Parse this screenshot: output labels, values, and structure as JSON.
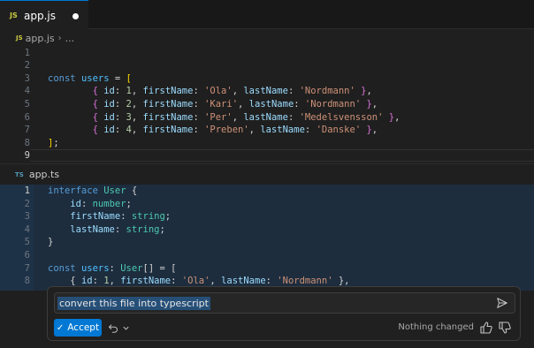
{
  "tab": {
    "icon": "JS",
    "filename": "app.js"
  },
  "breadcrumb": {
    "icon": "JS",
    "file": "app.js",
    "separator": "›",
    "more": "..."
  },
  "editor_lines": [
    {
      "num": "1",
      "tokens": []
    },
    {
      "num": "2",
      "tokens": []
    },
    {
      "num": "3",
      "tokens": [
        {
          "c": "kw",
          "t": "const"
        },
        {
          "c": "plain",
          "t": " "
        },
        {
          "c": "var",
          "t": "users"
        },
        {
          "c": "plain",
          "t": " = "
        },
        {
          "c": "br1",
          "t": "["
        }
      ]
    },
    {
      "num": "4",
      "tokens": [
        {
          "c": "plain",
          "t": "        "
        },
        {
          "c": "br2",
          "t": "{"
        },
        {
          "c": "plain",
          "t": " "
        },
        {
          "c": "prop",
          "t": "id"
        },
        {
          "c": "plain",
          "t": ": "
        },
        {
          "c": "num",
          "t": "1"
        },
        {
          "c": "plain",
          "t": ", "
        },
        {
          "c": "prop",
          "t": "firstName"
        },
        {
          "c": "plain",
          "t": ": "
        },
        {
          "c": "str",
          "t": "'Ola'"
        },
        {
          "c": "plain",
          "t": ", "
        },
        {
          "c": "prop",
          "t": "lastName"
        },
        {
          "c": "plain",
          "t": ": "
        },
        {
          "c": "str",
          "t": "'Nordmann'"
        },
        {
          "c": "plain",
          "t": " "
        },
        {
          "c": "br2",
          "t": "}"
        },
        {
          "c": "plain",
          "t": ","
        }
      ]
    },
    {
      "num": "5",
      "tokens": [
        {
          "c": "plain",
          "t": "        "
        },
        {
          "c": "br2",
          "t": "{"
        },
        {
          "c": "plain",
          "t": " "
        },
        {
          "c": "prop",
          "t": "id"
        },
        {
          "c": "plain",
          "t": ": "
        },
        {
          "c": "num",
          "t": "2"
        },
        {
          "c": "plain",
          "t": ", "
        },
        {
          "c": "prop",
          "t": "firstName"
        },
        {
          "c": "plain",
          "t": ": "
        },
        {
          "c": "str",
          "t": "'Kari'"
        },
        {
          "c": "plain",
          "t": ", "
        },
        {
          "c": "prop",
          "t": "lastName"
        },
        {
          "c": "plain",
          "t": ": "
        },
        {
          "c": "str",
          "t": "'Nordmann'"
        },
        {
          "c": "plain",
          "t": " "
        },
        {
          "c": "br2",
          "t": "}"
        },
        {
          "c": "plain",
          "t": ","
        }
      ]
    },
    {
      "num": "6",
      "tokens": [
        {
          "c": "plain",
          "t": "        "
        },
        {
          "c": "br2",
          "t": "{"
        },
        {
          "c": "plain",
          "t": " "
        },
        {
          "c": "prop",
          "t": "id"
        },
        {
          "c": "plain",
          "t": ": "
        },
        {
          "c": "num",
          "t": "3"
        },
        {
          "c": "plain",
          "t": ", "
        },
        {
          "c": "prop",
          "t": "firstName"
        },
        {
          "c": "plain",
          "t": ": "
        },
        {
          "c": "str",
          "t": "'Per'"
        },
        {
          "c": "plain",
          "t": ", "
        },
        {
          "c": "prop",
          "t": "lastName"
        },
        {
          "c": "plain",
          "t": ": "
        },
        {
          "c": "str",
          "t": "'Medelsvensson'"
        },
        {
          "c": "plain",
          "t": " "
        },
        {
          "c": "br2",
          "t": "}"
        },
        {
          "c": "plain",
          "t": ","
        }
      ]
    },
    {
      "num": "7",
      "tokens": [
        {
          "c": "plain",
          "t": "        "
        },
        {
          "c": "br2",
          "t": "{"
        },
        {
          "c": "plain",
          "t": " "
        },
        {
          "c": "prop",
          "t": "id"
        },
        {
          "c": "plain",
          "t": ": "
        },
        {
          "c": "num",
          "t": "4"
        },
        {
          "c": "plain",
          "t": ", "
        },
        {
          "c": "prop",
          "t": "firstName"
        },
        {
          "c": "plain",
          "t": ": "
        },
        {
          "c": "str",
          "t": "'Preben'"
        },
        {
          "c": "plain",
          "t": ", "
        },
        {
          "c": "prop",
          "t": "lastName"
        },
        {
          "c": "plain",
          "t": ": "
        },
        {
          "c": "str",
          "t": "'Danske'"
        },
        {
          "c": "plain",
          "t": " "
        },
        {
          "c": "br2",
          "t": "}"
        },
        {
          "c": "plain",
          "t": ","
        }
      ]
    },
    {
      "num": "8",
      "tokens": [
        {
          "c": "br1",
          "t": "]"
        },
        {
          "c": "plain",
          "t": ";"
        }
      ]
    },
    {
      "num": "9",
      "active": true,
      "tokens": []
    }
  ],
  "diff": {
    "icon": "TS",
    "filename": "app.ts",
    "lines": [
      {
        "num": "1",
        "active": true,
        "tokens": [
          {
            "c": "kw",
            "t": "interface"
          },
          {
            "c": "plain",
            "t": " "
          },
          {
            "c": "typ",
            "t": "User"
          },
          {
            "c": "plain",
            "t": " {"
          }
        ]
      },
      {
        "num": "2",
        "tokens": [
          {
            "c": "plain",
            "t": "    "
          },
          {
            "c": "prop",
            "t": "id"
          },
          {
            "c": "plain",
            "t": ": "
          },
          {
            "c": "typ",
            "t": "number"
          },
          {
            "c": "plain",
            "t": ";"
          }
        ]
      },
      {
        "num": "3",
        "tokens": [
          {
            "c": "plain",
            "t": "    "
          },
          {
            "c": "prop",
            "t": "firstName"
          },
          {
            "c": "plain",
            "t": ": "
          },
          {
            "c": "typ",
            "t": "string"
          },
          {
            "c": "plain",
            "t": ";"
          }
        ]
      },
      {
        "num": "4",
        "tokens": [
          {
            "c": "plain",
            "t": "    "
          },
          {
            "c": "prop",
            "t": "lastName"
          },
          {
            "c": "plain",
            "t": ": "
          },
          {
            "c": "typ",
            "t": "string"
          },
          {
            "c": "plain",
            "t": ";"
          }
        ]
      },
      {
        "num": "5",
        "tokens": [
          {
            "c": "plain",
            "t": "}"
          }
        ]
      },
      {
        "num": "6",
        "tokens": []
      },
      {
        "num": "7",
        "tokens": [
          {
            "c": "kw",
            "t": "const"
          },
          {
            "c": "plain",
            "t": " "
          },
          {
            "c": "var",
            "t": "users"
          },
          {
            "c": "plain",
            "t": ": "
          },
          {
            "c": "typ",
            "t": "User"
          },
          {
            "c": "plain",
            "t": "[] = ["
          }
        ]
      },
      {
        "num": "8",
        "tokens": [
          {
            "c": "plain",
            "t": "    { "
          },
          {
            "c": "prop",
            "t": "id"
          },
          {
            "c": "plain",
            "t": ": "
          },
          {
            "c": "num",
            "t": "1"
          },
          {
            "c": "plain",
            "t": ", "
          },
          {
            "c": "prop",
            "t": "firstName"
          },
          {
            "c": "plain",
            "t": ": "
          },
          {
            "c": "str",
            "t": "'Ola'"
          },
          {
            "c": "plain",
            "t": ", "
          },
          {
            "c": "prop",
            "t": "lastName"
          },
          {
            "c": "plain",
            "t": ": "
          },
          {
            "c": "str",
            "t": "'Nordmann'"
          },
          {
            "c": "plain",
            "t": " },"
          }
        ]
      }
    ]
  },
  "chat": {
    "prompt": "convert this file into typescript",
    "accept_label": "Accept",
    "status": "Nothing changed",
    "icons": {
      "send": "send-icon",
      "undo": "undo-icon",
      "chevron": "chevron-down-icon",
      "thumbs_up": "thumbs-up-icon",
      "thumbs_down": "thumbs-down-icon",
      "check": "check-icon"
    }
  },
  "colors": {
    "editor_bg": "#1f1f1f",
    "accent": "#0078d4",
    "diff_bg": "#1d2d3e",
    "selection": "#264f78"
  }
}
